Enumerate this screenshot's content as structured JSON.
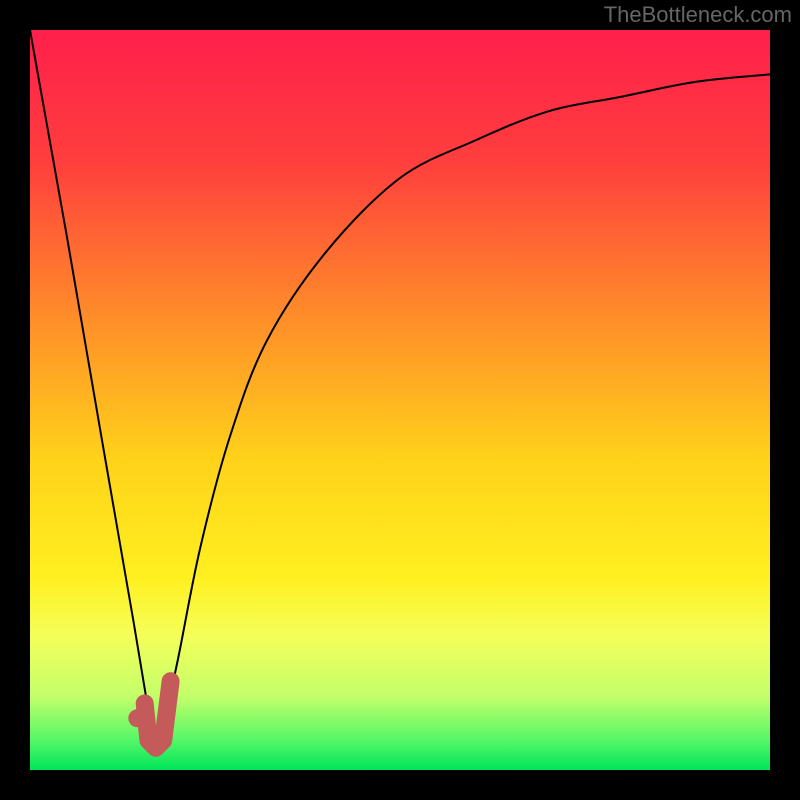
{
  "watermark": "TheBottleneck.com",
  "chart_data": {
    "type": "line",
    "title": "",
    "xlabel": "",
    "ylabel": "",
    "xlim": [
      0,
      100
    ],
    "ylim": [
      0,
      100
    ],
    "description": "Bottleneck curve visualization on thermal gradient background. Y-axis percent bottleneck (red=high, green=low). X-axis maps component performance ratio. Single black curve with a sharp V dip near x≈17. Pink/salmon J-shaped marker highlights the optimal region around x≈16–19.",
    "series": [
      {
        "name": "bottleneck-curve",
        "x": [
          0,
          5,
          10,
          14,
          16,
          17,
          18,
          20,
          23,
          27,
          32,
          40,
          50,
          60,
          70,
          80,
          90,
          100
        ],
        "y": [
          100,
          72,
          43,
          20,
          8,
          3,
          6,
          15,
          30,
          45,
          58,
          70,
          80,
          85,
          89,
          91,
          93,
          94
        ]
      }
    ],
    "marker": {
      "name": "optimal-j",
      "color": "#c55a5a",
      "points": [
        {
          "x": 15.5,
          "y": 9
        },
        {
          "x": 16,
          "y": 4
        },
        {
          "x": 17,
          "y": 3
        },
        {
          "x": 18,
          "y": 4
        },
        {
          "x": 19,
          "y": 12
        }
      ],
      "dot": {
        "x": 14.5,
        "y": 7
      }
    },
    "gradient_stops": [
      {
        "offset": 0,
        "color": "#ff1f4b"
      },
      {
        "offset": 18,
        "color": "#ff3f3d"
      },
      {
        "offset": 38,
        "color": "#ff8a2a"
      },
      {
        "offset": 58,
        "color": "#ffd21a"
      },
      {
        "offset": 74,
        "color": "#fff020"
      },
      {
        "offset": 82,
        "color": "#f4ff5a"
      },
      {
        "offset": 90,
        "color": "#c3ff6a"
      },
      {
        "offset": 96,
        "color": "#55f768"
      },
      {
        "offset": 100,
        "color": "#00e55a"
      }
    ]
  }
}
